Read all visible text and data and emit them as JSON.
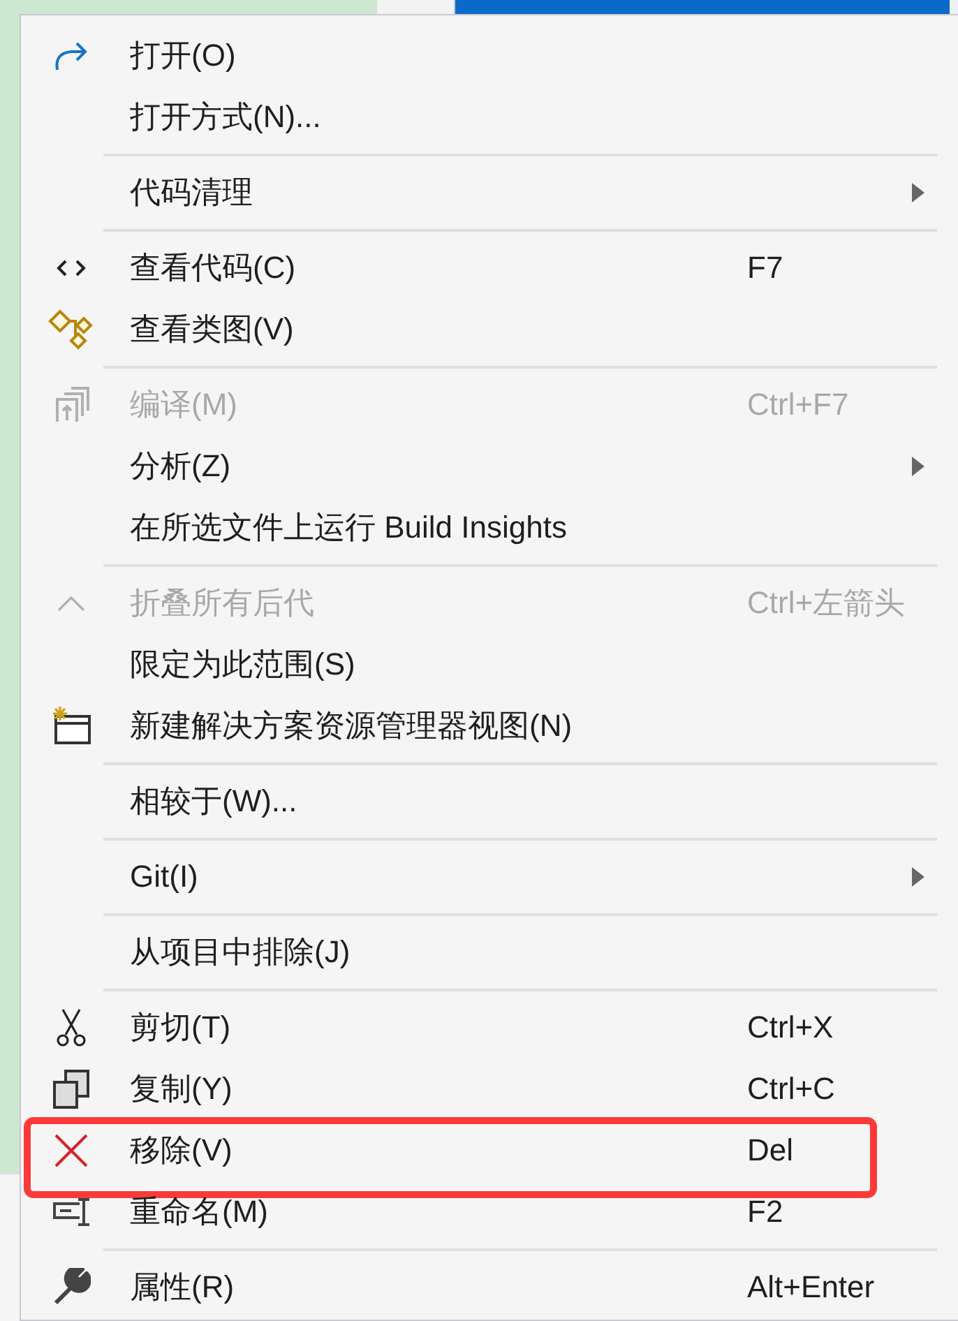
{
  "menu": {
    "items": [
      {
        "kind": "redo",
        "label": "打开(O)",
        "disabled": false,
        "submenu": false,
        "highlighted": false
      },
      {
        "kind": "plain",
        "label": "打开方式(N)...",
        "disabled": false,
        "submenu": false,
        "highlighted": false
      },
      {
        "kind": "separator"
      },
      {
        "kind": "plain",
        "label": "代码清理",
        "disabled": false,
        "submenu": true,
        "highlighted": false
      },
      {
        "kind": "separator"
      },
      {
        "kind": "code",
        "label": "查看代码(C)",
        "shortcut": "F7",
        "disabled": false,
        "submenu": false,
        "highlighted": false
      },
      {
        "kind": "diagram",
        "label": "查看类图(V)",
        "disabled": false,
        "submenu": false,
        "highlighted": false
      },
      {
        "kind": "separator"
      },
      {
        "kind": "build",
        "label": "编译(M)",
        "shortcut": "Ctrl+F7",
        "disabled": true,
        "submenu": false,
        "highlighted": false
      },
      {
        "kind": "plain",
        "label": "分析(Z)",
        "disabled": false,
        "submenu": true,
        "highlighted": false
      },
      {
        "kind": "plain",
        "label": "在所选文件上运行 Build Insights",
        "disabled": false,
        "submenu": false,
        "highlighted": false
      },
      {
        "kind": "separator"
      },
      {
        "kind": "collapse",
        "label": "折叠所有后代",
        "shortcut": "Ctrl+左箭头",
        "disabled": true,
        "submenu": false,
        "highlighted": false
      },
      {
        "kind": "plain",
        "label": "限定为此范围(S)",
        "disabled": false,
        "submenu": false,
        "highlighted": false
      },
      {
        "kind": "newview",
        "label": "新建解决方案资源管理器视图(N)",
        "disabled": false,
        "submenu": false,
        "highlighted": false
      },
      {
        "kind": "separator"
      },
      {
        "kind": "plain",
        "label": "相较于(W)...",
        "disabled": false,
        "submenu": false,
        "highlighted": false
      },
      {
        "kind": "separator"
      },
      {
        "kind": "plain",
        "label": "Git(I)",
        "disabled": false,
        "submenu": true,
        "highlighted": false
      },
      {
        "kind": "separator"
      },
      {
        "kind": "plain",
        "label": "从项目中排除(J)",
        "disabled": false,
        "submenu": false,
        "highlighted": false
      },
      {
        "kind": "separator"
      },
      {
        "kind": "cut",
        "label": "剪切(T)",
        "shortcut": "Ctrl+X",
        "disabled": false,
        "submenu": false,
        "highlighted": false
      },
      {
        "kind": "copy",
        "label": "复制(Y)",
        "shortcut": "Ctrl+C",
        "disabled": false,
        "submenu": false,
        "highlighted": false
      },
      {
        "kind": "remove",
        "label": "移除(V)",
        "shortcut": "Del",
        "disabled": false,
        "submenu": false,
        "highlighted": true
      },
      {
        "kind": "rename",
        "label": "重命名(M)",
        "shortcut": "F2",
        "disabled": false,
        "submenu": false,
        "highlighted": false
      },
      {
        "kind": "separator"
      },
      {
        "kind": "wrench",
        "label": "属性(R)",
        "shortcut": "Alt+Enter",
        "disabled": false,
        "submenu": false,
        "highlighted": false
      }
    ]
  }
}
